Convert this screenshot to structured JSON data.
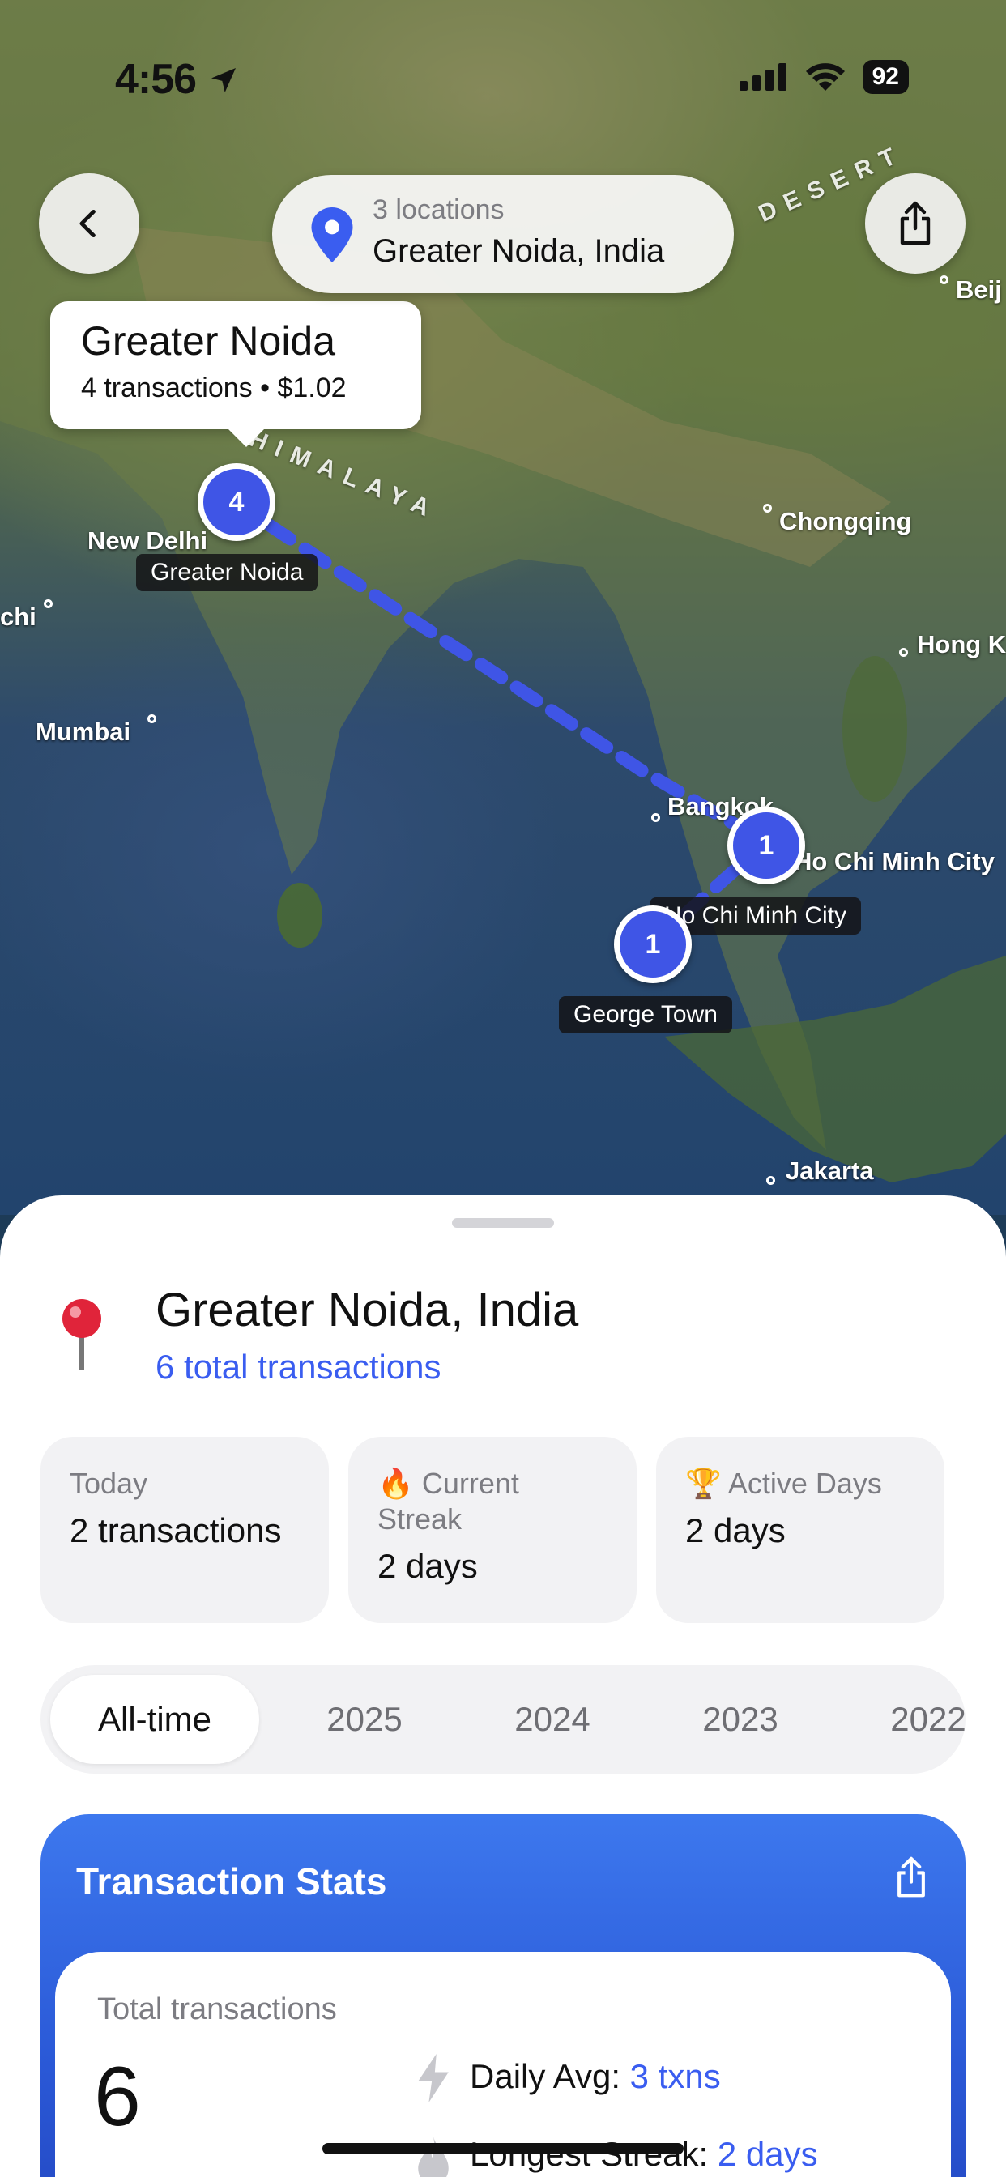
{
  "status_bar": {
    "time": "4:56",
    "battery": "92"
  },
  "top_bar": {
    "location_count": "3 locations",
    "location_name": "Greater Noida, India"
  },
  "callout": {
    "title": "Greater Noida",
    "subtitle": "4 transactions • $1.02"
  },
  "map": {
    "markers": [
      {
        "count": "4",
        "label": "Greater Noida"
      },
      {
        "count": "1",
        "label": "Ho Chi Minh City"
      },
      {
        "count": "1",
        "label": "George Town"
      }
    ],
    "cities": {
      "new_delhi": "New Delhi",
      "mumbai": "Mumbai",
      "chi": "chi",
      "chongqing": "Chongqing",
      "hong_kong": "Hong K",
      "bangkok": "Bangkok",
      "ho_chi_minh": "Ho Chi Minh City",
      "jakarta": "Jakarta",
      "beijing": "Beij"
    },
    "regions": {
      "himalaya": "HIMALAYA",
      "desert": "DESERT"
    },
    "route_color": "#3f55e6"
  },
  "sheet": {
    "title": "Greater Noida, India",
    "subtitle": "6 total transactions",
    "stats": [
      {
        "emoji": "",
        "label": "Today",
        "value": "2 transactions"
      },
      {
        "emoji": "🔥",
        "label": "Current Streak",
        "value": "2 days"
      },
      {
        "emoji": "🏆",
        "label": "Active Days",
        "value": "2 days"
      }
    ],
    "tabs": [
      "All-time",
      "2025",
      "2024",
      "2023",
      "2022"
    ],
    "active_tab": "All-time",
    "tx_card": {
      "title": "Transaction Stats",
      "total_label": "Total transactions",
      "total_value": "6",
      "daily_avg_label": "Daily Avg:",
      "daily_avg_value": "3 txns",
      "longest_streak_label": "Longest Streak:",
      "longest_streak_value": "2 days"
    }
  },
  "colors": {
    "accent": "#3a5df0",
    "card_blue": "#2f62e0",
    "marker": "#3f55e6"
  }
}
